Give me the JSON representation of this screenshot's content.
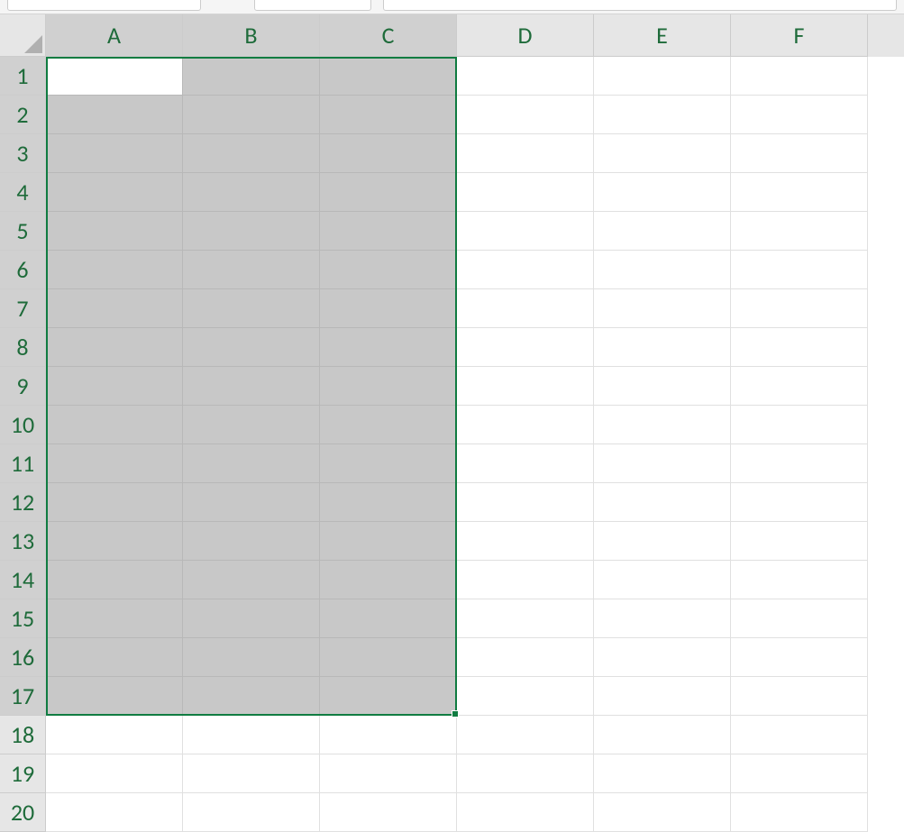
{
  "columns": [
    "A",
    "B",
    "C",
    "D",
    "E",
    "F"
  ],
  "rows": [
    "1",
    "2",
    "3",
    "4",
    "5",
    "6",
    "7",
    "8",
    "9",
    "10",
    "11",
    "12",
    "13",
    "14",
    "15",
    "16",
    "17",
    "18",
    "19",
    "20"
  ],
  "selection": {
    "startCol": 0,
    "endCol": 2,
    "startRow": 0,
    "endRow": 16,
    "activeCell": {
      "col": 0,
      "row": 0
    }
  },
  "selectedColumns": [
    "A",
    "B",
    "C"
  ],
  "selectedRows": [
    "1",
    "2",
    "3",
    "4",
    "5",
    "6",
    "7",
    "8",
    "9",
    "10",
    "11",
    "12",
    "13",
    "14",
    "15",
    "16",
    "17"
  ],
  "colors": {
    "selectionBorder": "#107c41",
    "headerText": "#1e6b3a"
  }
}
